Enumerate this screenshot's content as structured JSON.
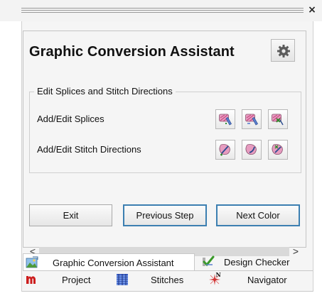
{
  "window": {
    "close_glyph": "×"
  },
  "panel": {
    "title": "Graphic Conversion Assistant",
    "settings_icon": "gear-icon"
  },
  "group": {
    "legend": "Edit Splices and Stitch Directions",
    "rows": [
      {
        "label": "Add/Edit Splices"
      },
      {
        "label": "Add/Edit Stitch Directions"
      }
    ]
  },
  "actions": {
    "exit": "Exit",
    "previous": "Previous Step",
    "next": "Next Color"
  },
  "scrollbar": {
    "left_arrow": "<",
    "right_arrow": ">"
  },
  "tabs": {
    "graphic_conversion_assistant": "Graphic Conversion Assistant",
    "design_checker": "Design Checker",
    "project": "Project",
    "stitches": "Stitches",
    "navigator": "Navigator"
  },
  "colors": {
    "focus_border": "#3c7fb1",
    "icon_blue": "#5a7fcf",
    "icon_pink": "#e79cc0",
    "brand_red": "#cc1d1d"
  }
}
